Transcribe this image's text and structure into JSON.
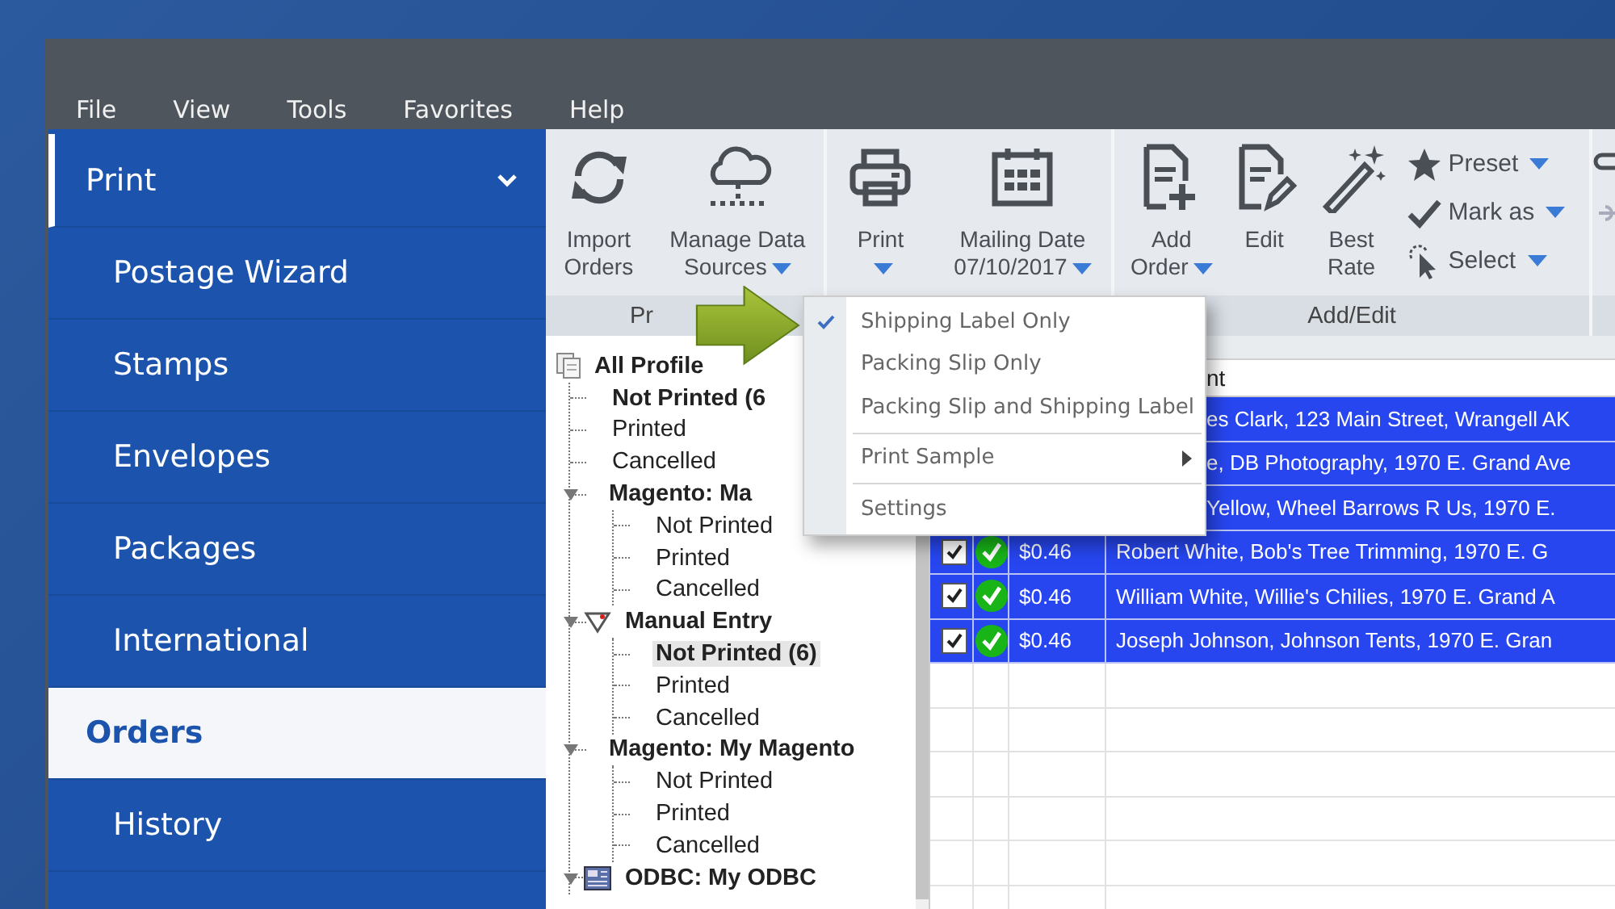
{
  "menu_bar": [
    "File",
    "View",
    "Tools",
    "Favorites",
    "Help"
  ],
  "sidebar": {
    "items": [
      {
        "label": "Print",
        "kind": "header",
        "expanded": true,
        "selected": false
      },
      {
        "label": "Postage Wizard",
        "kind": "item",
        "selected": false
      },
      {
        "label": "Stamps",
        "kind": "item",
        "selected": false
      },
      {
        "label": "Envelopes",
        "kind": "item",
        "selected": false
      },
      {
        "label": "Packages",
        "kind": "item",
        "selected": false
      },
      {
        "label": "International",
        "kind": "item",
        "selected": false
      },
      {
        "label": "Orders",
        "kind": "item",
        "selected": true
      },
      {
        "label": "History",
        "kind": "item",
        "selected": false
      }
    ]
  },
  "ribbon": {
    "groups": [
      {
        "label": "Pr",
        "buttons": [
          {
            "kind": "large",
            "lines": [
              "Import",
              "Orders"
            ],
            "dropdown": false
          },
          {
            "kind": "large",
            "lines": [
              "Manage Data",
              "Sources"
            ],
            "dropdown": true
          }
        ]
      },
      {
        "buttons": [
          {
            "kind": "large",
            "lines": [
              "Print"
            ],
            "dropdown": true
          },
          {
            "kind": "large",
            "lines": [
              "Mailing Date",
              "07/10/2017"
            ],
            "dropdown": true
          }
        ]
      },
      {
        "label": "Add/Edit",
        "buttons": [
          {
            "kind": "large",
            "lines": [
              "Add",
              "Order"
            ],
            "dropdown": true
          },
          {
            "kind": "large",
            "lines": [
              "Edit"
            ],
            "dropdown": false
          },
          {
            "kind": "large",
            "lines": [
              "Best",
              "Rate"
            ],
            "dropdown": false
          },
          {
            "kind": "small",
            "lines": [
              "Preset"
            ],
            "dropdown": true
          },
          {
            "kind": "small",
            "lines": [
              "Mark as"
            ],
            "dropdown": true
          },
          {
            "kind": "small",
            "lines": [
              "Select"
            ],
            "dropdown": true
          }
        ]
      }
    ]
  },
  "tree": {
    "nodes": [
      {
        "label": "All Profile",
        "kind": "profiles",
        "bold": true,
        "selected": false,
        "children": [
          {
            "label": "Not Printed (6",
            "bold": true,
            "selected": false
          },
          {
            "label": "Printed",
            "bold": false,
            "selected": false
          },
          {
            "label": "Cancelled",
            "bold": false,
            "selected": false
          },
          {
            "label": "Magento: Ma",
            "kind": "store",
            "bold": true,
            "selected": false,
            "expanded": true,
            "children": [
              {
                "label": "Not Printed",
                "bold": false,
                "selected": false
              },
              {
                "label": "Printed",
                "bold": false,
                "selected": false
              },
              {
                "label": "Cancelled",
                "bold": false,
                "selected": false
              }
            ]
          },
          {
            "label": "Manual Entry",
            "kind": "manual",
            "bold": true,
            "selected": false,
            "expanded": true,
            "children": [
              {
                "label": "Not Printed (6)",
                "bold": true,
                "selected": true
              },
              {
                "label": "Printed",
                "bold": false,
                "selected": false
              },
              {
                "label": "Cancelled",
                "bold": false,
                "selected": false
              }
            ]
          },
          {
            "label": "Magento: My Magento",
            "kind": "store",
            "bold": true,
            "selected": false,
            "expanded": true,
            "children": [
              {
                "label": "Not Printed",
                "bold": false,
                "selected": false
              },
              {
                "label": "Printed",
                "bold": false,
                "selected": false
              },
              {
                "label": "Cancelled",
                "bold": false,
                "selected": false
              }
            ]
          },
          {
            "label": "ODBC: My ODBC",
            "kind": "database",
            "bold": true,
            "selected": false,
            "expanded": true
          }
        ]
      }
    ]
  },
  "table": {
    "column_4": "nt",
    "rows": [
      {
        "kind": "partial",
        "selected": true,
        "name": "es Clark, 123 Main Street, Wrangell AK"
      },
      {
        "kind": "partial",
        "selected": true,
        "name": "e, DB Photography, 1970 E. Grand Ave"
      },
      {
        "kind": "partial",
        "selected": true,
        "name": "Yellow, Wheel Barrows R Us, 1970 E."
      },
      {
        "kind": "full",
        "selected": true,
        "checked": true,
        "ok": true,
        "price": "$0.46",
        "name": "Robert White, Bob's Tree Trimming, 1970 E. G"
      },
      {
        "kind": "full",
        "selected": true,
        "checked": true,
        "ok": true,
        "price": "$0.46",
        "name": "William White, Willie's Chilies, 1970 E. Grand A"
      },
      {
        "kind": "full",
        "selected": true,
        "checked": true,
        "ok": true,
        "price": "$0.46",
        "name": "Joseph Johnson, Johnson Tents, 1970 E. Gran"
      }
    ]
  },
  "print_menu": {
    "items": [
      {
        "kind": "option",
        "label": "Shipping Label Only",
        "checked": true
      },
      {
        "kind": "option",
        "label": "Packing Slip Only",
        "checked": false
      },
      {
        "kind": "option",
        "label": "Packing Slip and Shipping Label",
        "checked": false
      },
      {
        "kind": "separator"
      },
      {
        "kind": "submenu",
        "label": "Print Sample"
      },
      {
        "kind": "separator"
      },
      {
        "kind": "option",
        "label": "Settings",
        "checked": false
      }
    ]
  }
}
